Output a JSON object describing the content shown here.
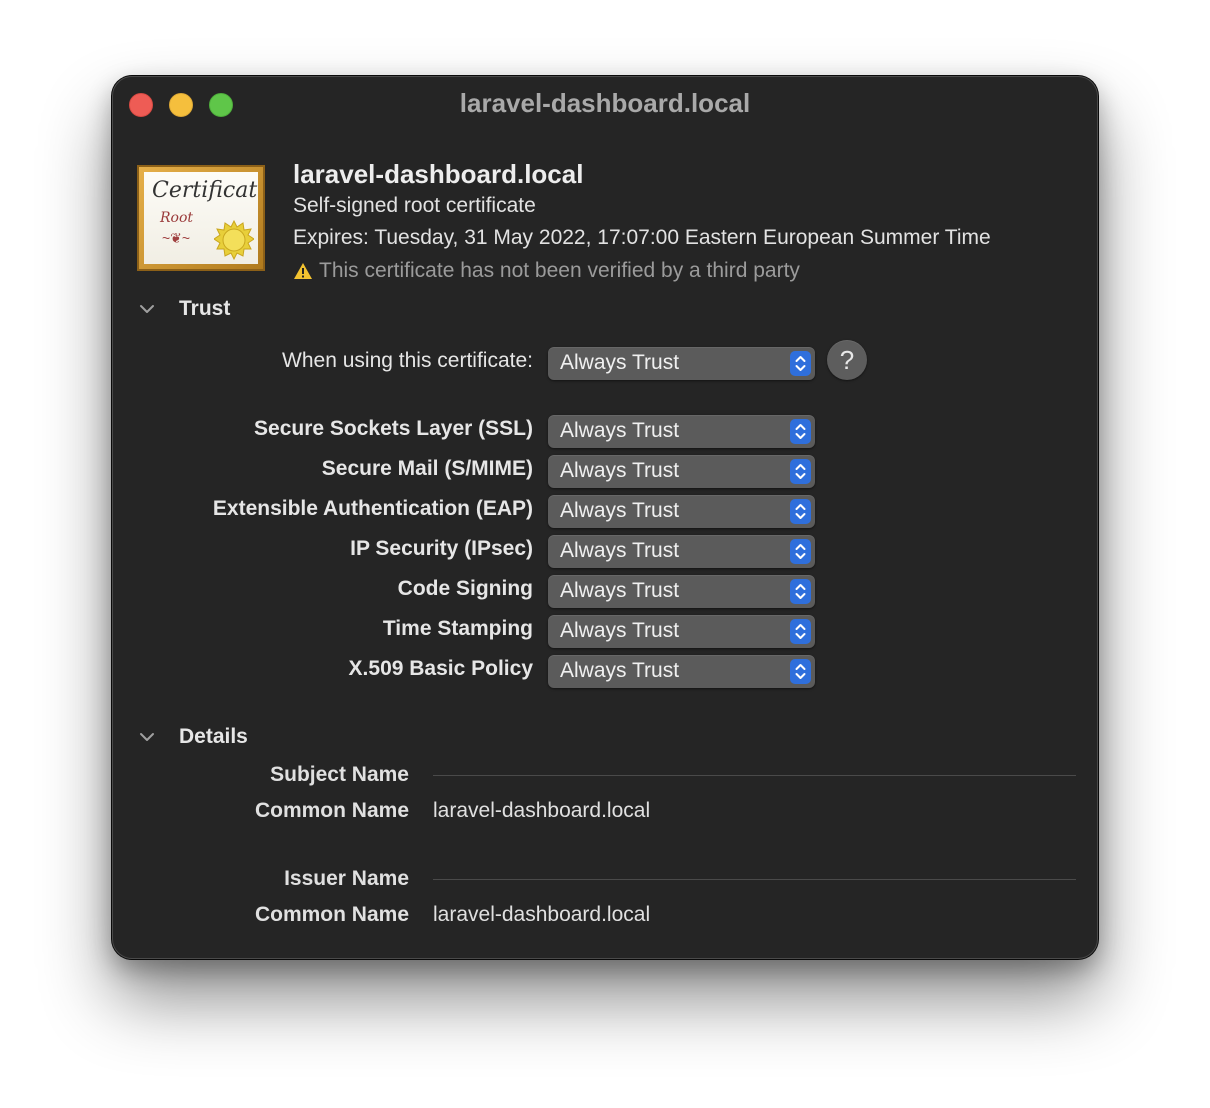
{
  "window": {
    "title": "laravel-dashboard.local"
  },
  "header": {
    "icon": "certificate-root-icon",
    "name": "laravel-dashboard.local",
    "kind": "Self-signed root certificate",
    "expires": "Expires: Tuesday, 31 May 2022, 17:07:00 Eastern European Summer Time",
    "warning": "This certificate has not been verified by a third party",
    "certificate_text": "Certificate",
    "certificate_sub": "Root"
  },
  "trust": {
    "title": "Trust",
    "when_using": {
      "label": "When using this certificate:",
      "value": "Always Trust"
    },
    "help_label": "?",
    "policies": [
      {
        "label": "Secure Sockets Layer (SSL)",
        "value": "Always Trust"
      },
      {
        "label": "Secure Mail (S/MIME)",
        "value": "Always Trust"
      },
      {
        "label": "Extensible Authentication (EAP)",
        "value": "Always Trust"
      },
      {
        "label": "IP Security (IPsec)",
        "value": "Always Trust"
      },
      {
        "label": "Code Signing",
        "value": "Always Trust"
      },
      {
        "label": "Time Stamping",
        "value": "Always Trust"
      },
      {
        "label": "X.509 Basic Policy",
        "value": "Always Trust"
      }
    ]
  },
  "details": {
    "title": "Details",
    "subject": {
      "heading": "Subject Name",
      "label": "Common Name",
      "value": "laravel-dashboard.local"
    },
    "issuer": {
      "heading": "Issuer Name",
      "label": "Common Name",
      "value": "laravel-dashboard.local"
    }
  },
  "colors": {
    "window_bg": "#252525",
    "popup_bg": "#5b5b5b",
    "stepper_blue": "#2f6fdc",
    "warning_yellow": "#f2c230"
  }
}
